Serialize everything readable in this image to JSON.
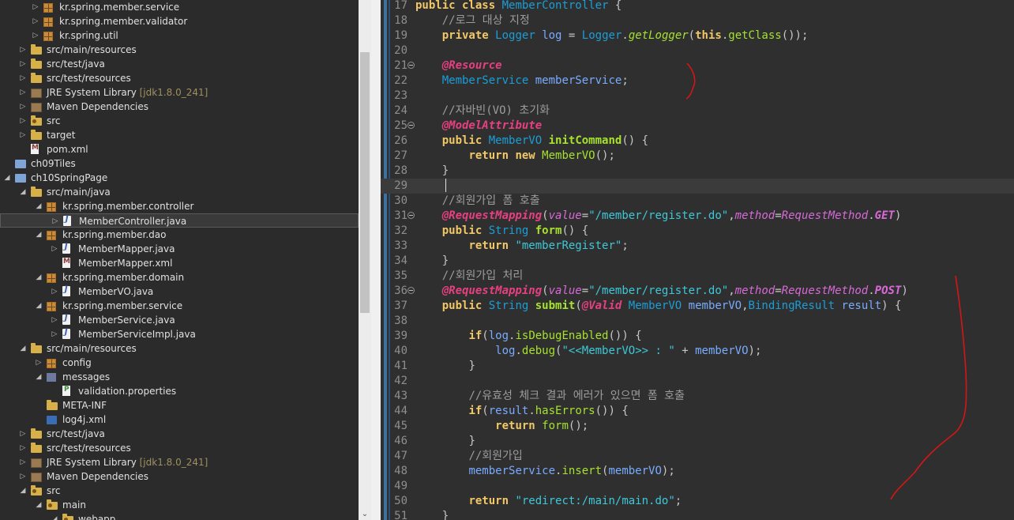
{
  "explorer": {
    "rows": [
      {
        "twisty": "right",
        "icon": "package",
        "label": "kr.spring.member.service"
      },
      {
        "twisty": "right",
        "icon": "package",
        "label": "kr.spring.member.validator"
      },
      {
        "twisty": "right",
        "icon": "package",
        "label": "kr.spring.util"
      },
      {
        "twisty": "right",
        "icon": "folder",
        "label": "src/main/resources"
      },
      {
        "twisty": "right",
        "icon": "folder",
        "label": "src/test/java"
      },
      {
        "twisty": "right",
        "icon": "folder",
        "label": "src/test/resources"
      },
      {
        "twisty": "right",
        "icon": "library",
        "label": "JRE System Library",
        "suffix": "[jdk1.8.0_241]"
      },
      {
        "twisty": "right",
        "icon": "library",
        "label": "Maven Dependencies"
      },
      {
        "twisty": "right",
        "icon": "src-folder",
        "label": "src"
      },
      {
        "twisty": "right",
        "icon": "folder",
        "label": "target"
      },
      {
        "twisty": "none",
        "icon": "xml-file",
        "label": "pom.xml"
      },
      {
        "twisty": "none",
        "icon": "project",
        "label": "ch09Tiles"
      },
      {
        "twisty": "down",
        "icon": "project",
        "label": "ch10SpringPage"
      },
      {
        "twisty": "down",
        "icon": "folder",
        "label": "src/main/java"
      },
      {
        "twisty": "down",
        "icon": "package",
        "label": "kr.spring.member.controller"
      },
      {
        "twisty": "right",
        "icon": "java-file",
        "label": "MemberController.java",
        "selected": true
      },
      {
        "twisty": "down",
        "icon": "package",
        "label": "kr.spring.member.dao"
      },
      {
        "twisty": "right",
        "icon": "java-file",
        "label": "MemberMapper.java"
      },
      {
        "twisty": "none",
        "icon": "xml-file",
        "label": "MemberMapper.xml"
      },
      {
        "twisty": "down",
        "icon": "package",
        "label": "kr.spring.member.domain"
      },
      {
        "twisty": "right",
        "icon": "java-file",
        "label": "MemberVO.java"
      },
      {
        "twisty": "down",
        "icon": "package",
        "label": "kr.spring.member.service"
      },
      {
        "twisty": "right",
        "icon": "java-file",
        "label": "MemberService.java"
      },
      {
        "twisty": "right",
        "icon": "java-file",
        "label": "MemberServiceImpl.java"
      },
      {
        "twisty": "down",
        "icon": "folder",
        "label": "src/main/resources"
      },
      {
        "twisty": "right",
        "icon": "package",
        "label": "config"
      },
      {
        "twisty": "down",
        "icon": "messages",
        "label": "messages"
      },
      {
        "twisty": "none",
        "icon": "properties-file",
        "label": "validation.properties"
      },
      {
        "twisty": "none",
        "icon": "folder",
        "label": "META-INF"
      },
      {
        "twisty": "none",
        "icon": "xml-generic",
        "label": "log4j.xml"
      },
      {
        "twisty": "right",
        "icon": "folder",
        "label": "src/test/java"
      },
      {
        "twisty": "right",
        "icon": "folder",
        "label": "src/test/resources"
      },
      {
        "twisty": "right",
        "icon": "library",
        "label": "JRE System Library",
        "suffix": "[jdk1.8.0_241]"
      },
      {
        "twisty": "right",
        "icon": "library",
        "label": "Maven Dependencies"
      },
      {
        "twisty": "down",
        "icon": "src-folder",
        "label": "src"
      },
      {
        "twisty": "down",
        "icon": "src-folder",
        "label": "main"
      },
      {
        "twisty": "down",
        "icon": "src-folder",
        "label": "webapp"
      }
    ]
  },
  "scrollbar": {
    "down_arrow": "⌄"
  },
  "editor": {
    "lines": [
      {
        "n": "17",
        "c": "<span class=\"kw\">public class</span> <span class=\"ty\">MemberController</span> <span class=\"pl\">{</span>"
      },
      {
        "n": "18",
        "c": "    <span class=\"cm\">//로그 대상 지정</span>"
      },
      {
        "n": "19",
        "c": "    <span class=\"kw\">private</span> <span class=\"ty\">Logger</span> <span class=\"idn\">log</span> <span class=\"pl\">=</span> <span class=\"ty\">Logger</span><span class=\"pl\">.</span><span class=\"fni\">getLogger</span><span class=\"pl\">(</span><span class=\"kw\">this</span><span class=\"pl\">.</span><span class=\"fn\">getClass</span><span class=\"pl\">());</span>"
      },
      {
        "n": "20",
        "c": ""
      },
      {
        "n": "21",
        "fold": true,
        "c": "    <span class=\"an\">@Resource</span>"
      },
      {
        "n": "22",
        "c": "    <span class=\"ty\">MemberService</span> <span class=\"idn\">memberService</span><span class=\"pl\">;</span>"
      },
      {
        "n": "23",
        "c": ""
      },
      {
        "n": "24",
        "c": "    <span class=\"cm\">//자바빈(VO) 초기화</span>"
      },
      {
        "n": "25",
        "fold": true,
        "c": "    <span class=\"an\">@ModelAttribute</span>"
      },
      {
        "n": "26",
        "c": "    <span class=\"kw\">public</span> <span class=\"ty\">MemberVO</span> <span class=\"fnb\">initCommand</span><span class=\"pl\">() {</span>"
      },
      {
        "n": "27",
        "c": "        <span class=\"kw\">return new</span> <span class=\"fn\">MemberVO</span><span class=\"pl\">();</span>"
      },
      {
        "n": "28",
        "c": "    <span class=\"pl\">}</span>"
      },
      {
        "n": "29",
        "current": true,
        "c": ""
      },
      {
        "n": "30",
        "c": "    <span class=\"cm\">//회원가입 폼 호출</span>"
      },
      {
        "n": "31",
        "fold": true,
        "c": "    <span class=\"an\">@RequestMapping</span><span class=\"pl\">(</span><span class=\"ce\">value</span><span class=\"pl\">=</span><span class=\"st\">\"/member/register.do\"</span><span class=\"pl\">,</span><span class=\"ce\">method</span><span class=\"pl\">=</span><span class=\"ce\">RequestMethod</span><span class=\"pl\">.</span><span class=\"ceb\">GET</span><span class=\"pl\">)</span>"
      },
      {
        "n": "32",
        "c": "    <span class=\"kw\">public</span> <span class=\"ty\">String</span> <span class=\"fnb\">form</span><span class=\"pl\">() {</span>"
      },
      {
        "n": "33",
        "c": "        <span class=\"kw\">return</span> <span class=\"st\">\"memberRegister\"</span><span class=\"pl\">;</span>"
      },
      {
        "n": "34",
        "c": "    <span class=\"pl\">}</span>"
      },
      {
        "n": "35",
        "c": "    <span class=\"cm\">//회원가입 처리</span>"
      },
      {
        "n": "36",
        "fold": true,
        "c": "    <span class=\"an\">@RequestMapping</span><span class=\"pl\">(</span><span class=\"ce\">value</span><span class=\"pl\">=</span><span class=\"st\">\"/member/register.do\"</span><span class=\"pl\">,</span><span class=\"ce\">method</span><span class=\"pl\">=</span><span class=\"ce\">RequestMethod</span><span class=\"pl\">.</span><span class=\"ceb\">POST</span><span class=\"pl\">)</span>"
      },
      {
        "n": "37",
        "c": "    <span class=\"kw\">public</span> <span class=\"ty\">String</span> <span class=\"fnb\">submit</span><span class=\"pl\">(</span><span class=\"an\">@Valid</span> <span class=\"ty\">MemberVO</span> <span class=\"idn\">memberVO</span><span class=\"pl\">,</span><span class=\"ty\">BindingResult</span> <span class=\"idn\">result</span><span class=\"pl\">) {</span>"
      },
      {
        "n": "38",
        "c": ""
      },
      {
        "n": "39",
        "c": "        <span class=\"kw\">if</span><span class=\"pl\">(</span><span class=\"idn\">log</span><span class=\"pl\">.</span><span class=\"fn\">isDebugEnabled</span><span class=\"pl\">()) {</span>"
      },
      {
        "n": "40",
        "c": "            <span class=\"idn\">log</span><span class=\"pl\">.</span><span class=\"fn\">debug</span><span class=\"pl\">(</span><span class=\"st\">\"&lt;&lt;MemberVO&gt;&gt; : \"</span> <span class=\"pl\">+</span> <span class=\"idn\">memberVO</span><span class=\"pl\">);</span>"
      },
      {
        "n": "41",
        "c": "        <span class=\"pl\">}</span>"
      },
      {
        "n": "42",
        "c": ""
      },
      {
        "n": "43",
        "c": "        <span class=\"cm\">//유효성 체크 결과 에러가 있으면 폼 호출</span>"
      },
      {
        "n": "44",
        "c": "        <span class=\"kw\">if</span><span class=\"pl\">(</span><span class=\"idn\">result</span><span class=\"pl\">.</span><span class=\"fn\">hasErrors</span><span class=\"pl\">()) {</span>"
      },
      {
        "n": "45",
        "c": "            <span class=\"kw\">return</span> <span class=\"fn\">form</span><span class=\"pl\">();</span>"
      },
      {
        "n": "46",
        "c": "        <span class=\"pl\">}</span>"
      },
      {
        "n": "47",
        "c": "        <span class=\"cm\">//회원가입</span>"
      },
      {
        "n": "48",
        "c": "        <span class=\"idn\">memberService</span><span class=\"pl\">.</span><span class=\"fn\">insert</span><span class=\"pl\">(</span><span class=\"idn\">memberVO</span><span class=\"pl\">);</span>"
      },
      {
        "n": "49",
        "c": ""
      },
      {
        "n": "50",
        "c": "        <span class=\"kw\">return</span> <span class=\"st\">\"redirect:/main/main.do\"</span><span class=\"pl\">;</span>"
      },
      {
        "n": "51",
        "c": "    <span class=\"pl\">}</span>"
      }
    ]
  }
}
